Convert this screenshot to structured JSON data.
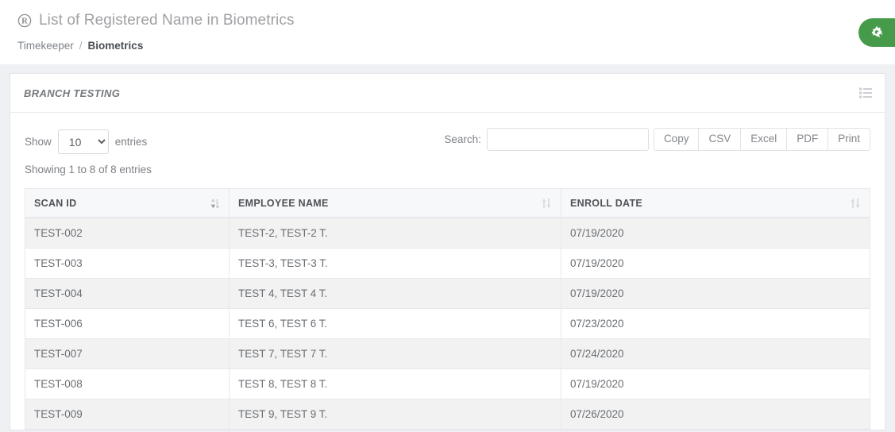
{
  "header": {
    "icon": "registered-trademark-icon",
    "title": "List of Registered Name in Biometrics",
    "breadcrumb": {
      "parent": "Timekeeper",
      "separator": "/",
      "current": "Biometrics"
    },
    "action_button": {
      "icon": "cogs-icon",
      "label": "",
      "color": "#469b4b"
    }
  },
  "panel": {
    "title": "BRANCH TESTING",
    "tools_icon": "list-menu-icon"
  },
  "datatable": {
    "length": {
      "prefix_label": "Show",
      "suffix_label": "entries",
      "selected": "10",
      "options": [
        "10",
        "25",
        "50",
        "100"
      ]
    },
    "search": {
      "label": "Search:",
      "value": "",
      "placeholder": ""
    },
    "export_buttons": [
      {
        "label": "Copy"
      },
      {
        "label": "CSV"
      },
      {
        "label": "Excel"
      },
      {
        "label": "PDF"
      },
      {
        "label": "Print"
      }
    ],
    "info": "Showing 1 to 8 of 8 entries",
    "columns": [
      {
        "label": "SCAN ID",
        "sort": "asc"
      },
      {
        "label": "EMPLOYEE NAME",
        "sort": "none"
      },
      {
        "label": "ENROLL DATE",
        "sort": "none"
      }
    ],
    "rows": [
      {
        "scan_id": "TEST-002",
        "employee_name": "TEST-2, TEST-2 T.",
        "enroll_date": "07/19/2020"
      },
      {
        "scan_id": "TEST-003",
        "employee_name": "TEST-3, TEST-3 T.",
        "enroll_date": "07/19/2020"
      },
      {
        "scan_id": "TEST-004",
        "employee_name": "TEST 4, TEST 4 T.",
        "enroll_date": "07/19/2020"
      },
      {
        "scan_id": "TEST-006",
        "employee_name": "TEST 6, TEST 6 T.",
        "enroll_date": "07/23/2020"
      },
      {
        "scan_id": "TEST-007",
        "employee_name": "TEST 7, TEST 7 T.",
        "enroll_date": "07/24/2020"
      },
      {
        "scan_id": "TEST-008",
        "employee_name": "TEST 8, TEST 8 T.",
        "enroll_date": "07/19/2020"
      },
      {
        "scan_id": "TEST-009",
        "employee_name": "TEST 9, TEST 9 T.",
        "enroll_date": "07/26/2020"
      }
    ]
  }
}
